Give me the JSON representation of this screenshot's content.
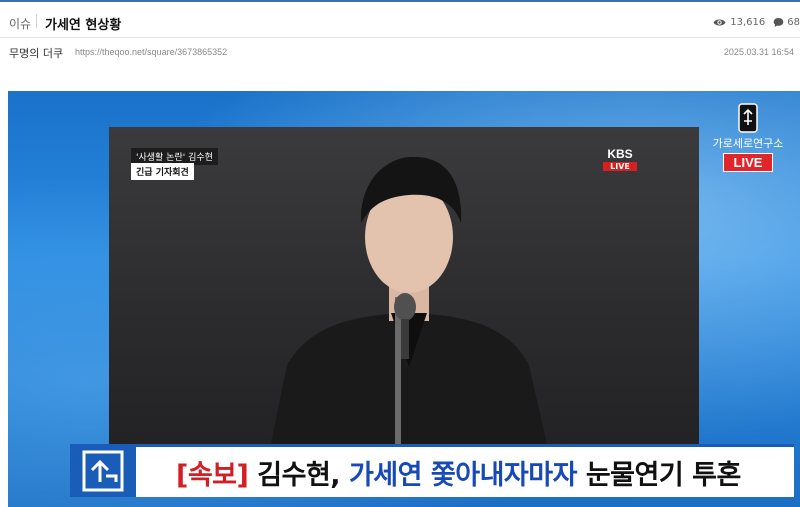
{
  "header": {
    "category": "이슈",
    "title": "가세연 현상황",
    "views": "13,616",
    "comments": "68"
  },
  "meta": {
    "author": "무명의 더쿠",
    "url": "https://theqoo.net/square/3673865352",
    "date": "2025.03.31 16:54"
  },
  "broadcast": {
    "caption_top": "'사생활 논란' 김수현",
    "caption_bottom": "긴급 기자회견",
    "network": "KBS",
    "network_live": "LIVE",
    "channel_name": "가로세로연구소",
    "channel_live": "LIVE"
  },
  "ticker": {
    "flash": "[속보]",
    "part1": "김수현,",
    "part2": "가세연 쫓아내자마자",
    "part3": "눈물연기 투혼"
  },
  "colors": {
    "accent_blue": "#1a5db8",
    "live_red": "#e0262a",
    "flash_red": "#d11f25"
  },
  "icons": [
    "eye-icon",
    "comment-icon",
    "channel-logo-icon",
    "ticker-logo-icon"
  ]
}
